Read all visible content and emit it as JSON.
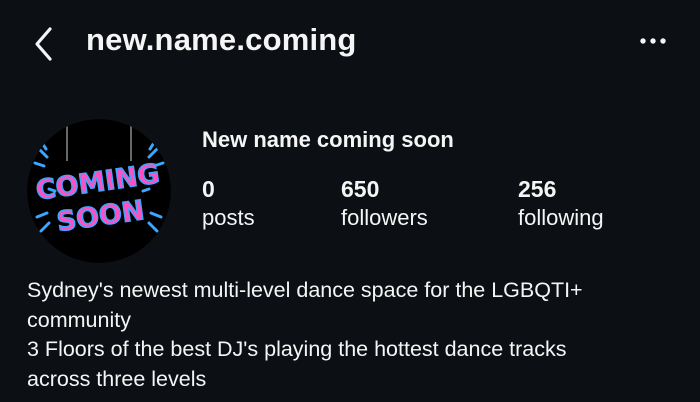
{
  "header": {
    "back_icon": "chevron-left-icon",
    "username": "new.name.coming",
    "more_icon": "more-horizontal-icon"
  },
  "profile": {
    "avatar_text_line1": "COMING",
    "avatar_text_line2": "SOON",
    "display_name": "New name coming soon",
    "stats": {
      "posts": {
        "count": "0",
        "label": "posts"
      },
      "followers": {
        "count": "650",
        "label": "followers"
      },
      "following": {
        "count": "256",
        "label": "following"
      }
    },
    "bio": {
      "line1": "Sydney's newest multi-level dance space for the LGBQTI+",
      "line2": "community",
      "line3": "3 Floors of the best DJ's playing the hottest dance tracks",
      "line4": "across three levels"
    }
  },
  "colors": {
    "background": "#0c1014",
    "text": "#f5f5f5",
    "avatar_pink": "#ff4fc3",
    "avatar_blue": "#3aa6ff"
  }
}
